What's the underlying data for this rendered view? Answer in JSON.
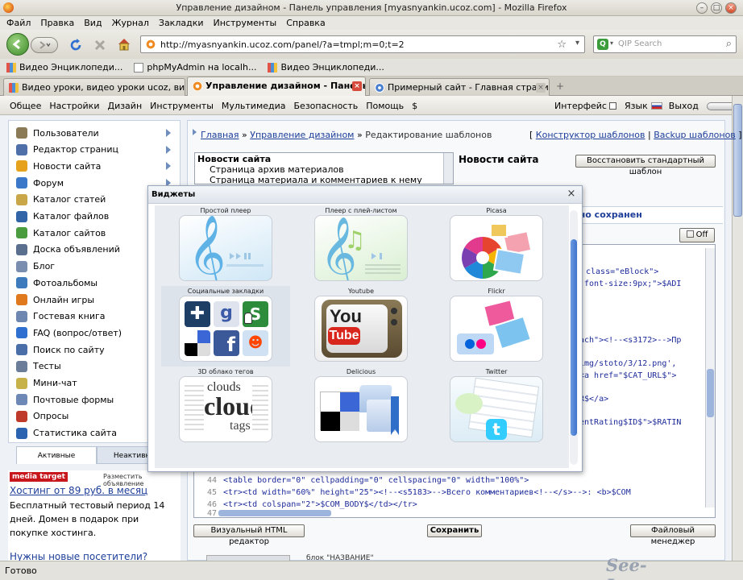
{
  "window": {
    "title": "Управление дизайном - Панель управления [myasnyankin.ucoz.com] - Mozilla Firefox"
  },
  "menubar": [
    "Файл",
    "Правка",
    "Вид",
    "Журнал",
    "Закладки",
    "Инструменты",
    "Справка"
  ],
  "nav": {
    "url": "http://myasnyankin.ucoz.com/panel/?a=tmpl;m=0;t=2",
    "search_placeholder": "QIP Search"
  },
  "bookmarks": [
    "Видео Энциклопеди...",
    "phpMyAdmin на localh...",
    "Видео Энциклопеди..."
  ],
  "tabs": [
    {
      "label": "Видео уроки, видео уроки ucoz, вид..."
    },
    {
      "label": "Управление дизайном - Панель ..."
    },
    {
      "label": "Примерный сайт - Главная страница"
    }
  ],
  "admin_menu": {
    "items": [
      "Общее",
      "Настройки",
      "Дизайн",
      "Инструменты",
      "Мультимедиа",
      "Безопасность",
      "Помощь",
      "$"
    ],
    "interface": "Интерфейс",
    "language": "Язык",
    "logout": "Выход"
  },
  "sidebar": {
    "items": [
      {
        "label": "Пользователи",
        "icon": "users-icon",
        "color": "#8a7a55",
        "arrow": true
      },
      {
        "label": "Редактор страниц",
        "icon": "page-editor-icon",
        "color": "#4f6fa8",
        "arrow": true
      },
      {
        "label": "Новости сайта",
        "icon": "news-icon",
        "color": "#e7a21d",
        "arrow": true
      },
      {
        "label": "Форум",
        "icon": "forum-icon",
        "color": "#3b78c9",
        "arrow": true
      },
      {
        "label": "Каталог статей",
        "icon": "articles-icon",
        "color": "#c9a648",
        "arrow": false
      },
      {
        "label": "Каталог файлов",
        "icon": "files-icon",
        "color": "#3264a8",
        "arrow": false
      },
      {
        "label": "Каталог сайтов",
        "icon": "sites-icon",
        "color": "#4a9c3f",
        "arrow": false
      },
      {
        "label": "Доска объявлений",
        "icon": "board-icon",
        "color": "#5a6f8e",
        "arrow": false
      },
      {
        "label": "Блог",
        "icon": "blog-icon",
        "color": "#7a8fb0",
        "arrow": false
      },
      {
        "label": "Фотоальбомы",
        "icon": "photo-icon",
        "color": "#3d7bbd",
        "arrow": false
      },
      {
        "label": "Онлайн игры",
        "icon": "games-icon",
        "color": "#e0781d",
        "arrow": false
      },
      {
        "label": "Гостевая книга",
        "icon": "guestbook-icon",
        "color": "#6d87b0",
        "arrow": false
      },
      {
        "label": "FAQ (вопрос/ответ)",
        "icon": "faq-icon",
        "color": "#2f6fcf",
        "arrow": false
      },
      {
        "label": "Поиск по сайту",
        "icon": "search-icon",
        "color": "#4a6ea8",
        "arrow": false
      },
      {
        "label": "Тесты",
        "icon": "tests-icon",
        "color": "#6b7d99",
        "arrow": false
      },
      {
        "label": "Мини-чат",
        "icon": "chat-icon",
        "color": "#c7b24a",
        "arrow": false
      },
      {
        "label": "Почтовые формы",
        "icon": "mail-icon",
        "color": "#6e88b5",
        "arrow": false
      },
      {
        "label": "Опросы",
        "icon": "poll-icon",
        "color": "#c03a2b",
        "arrow": false
      },
      {
        "label": "Статистика сайта",
        "icon": "stats-icon",
        "color": "#2c63b0",
        "arrow": false
      }
    ],
    "tabs": [
      "Активные",
      "Неактивные"
    ]
  },
  "ad": {
    "brand": "media target",
    "place_ad": "Разместить объявление",
    "headline": "Хостинг от 89 руб. в месяц",
    "body": "Бесплатный тестовый период 14 дней. Домен в подарок при покупке хостинга.",
    "headline2": "Нужны новые посетители?"
  },
  "breadcrumb": {
    "home": "Главная",
    "design": "Управление дизайном",
    "current": "Редактирование шаблонов",
    "constructor": "Конструктор шаблонов",
    "backup": "Backup шаблонов"
  },
  "templates": {
    "group": "Новости сайта",
    "items": [
      "Страница архив материалов",
      "Страница материала и комментариев к нему"
    ],
    "heading": "Новости сайта",
    "restore_button": "Восстановить стандартный шаблон",
    "saved_fragment": "шно сохранен",
    "off_label": "Off"
  },
  "code_partial": [
    "class=\"eBlock\">",
    ":font-size:9px;\">$ADI",
    "ach\"><!--<s3172>-->Пр",
    "img/stoto/3/12.png',",
    "<a href=\"$CAT_URL$\">",
    "R$</a>",
    "entRating$ID$\">$RATIN"
  ],
  "code_lines": [
    {
      "no": "44",
      "text": "<table border=\"0\" cellpadding=\"0\" cellspacing=\"0\" width=\"100%\">"
    },
    {
      "no": "45",
      "text": "<tr><td width=\"60%\" height=\"25\"><!--<s5183>-->Всего комментариев<!--</s>-->: <b>$COM"
    },
    {
      "no": "46",
      "text": "<tr><td colspan=\"2\">$COM_BODY$</td></tr>"
    },
    {
      "no": "47",
      "text": ""
    }
  ],
  "buttons": {
    "visual_editor": "Визуальный HTML редактор",
    "save": "Сохранить",
    "file_manager": "Файловый менеджер"
  },
  "bottom_partial": "блок \"НАЗВАНИЕ\"",
  "widgets": {
    "title": "Виджеты",
    "items": [
      {
        "label": "Простой плеер",
        "icon": "simple-player-icon"
      },
      {
        "label": "Плеер с плей-листом",
        "icon": "playlist-player-icon"
      },
      {
        "label": "Picasa",
        "icon": "picasa-icon"
      },
      {
        "label": "Социальные закладки",
        "icon": "social-bookmarks-icon"
      },
      {
        "label": "Youtube",
        "icon": "youtube-icon"
      },
      {
        "label": "Flickr",
        "icon": "flickr-icon"
      },
      {
        "label": "3D облако тегов",
        "icon": "tag-cloud-icon"
      },
      {
        "label": "Delicious",
        "icon": "delicious-icon"
      },
      {
        "label": "Twitter",
        "icon": "twitter-icon"
      }
    ],
    "cloud_words": [
      "clouds",
      "cloud",
      "tags"
    ],
    "youtube_word": "You",
    "youtube_tube": "Tube"
  },
  "status": {
    "text": "Готово",
    "watermark": "See-Lessons.ru"
  }
}
